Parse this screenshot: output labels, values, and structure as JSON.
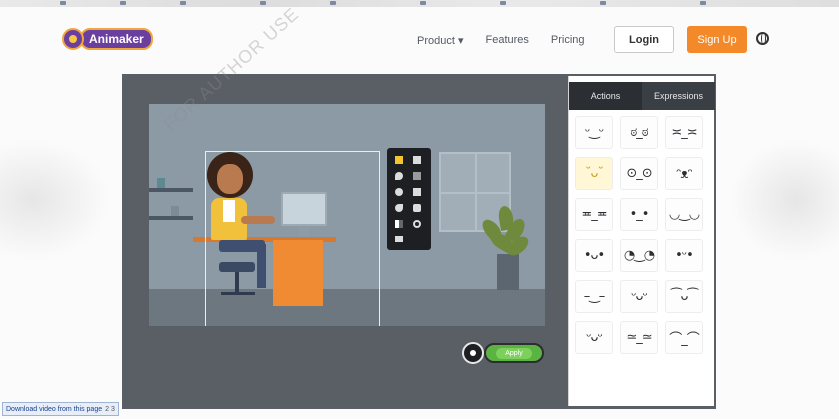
{
  "logo": {
    "text": "Animaker"
  },
  "nav": {
    "product": "Product ▾",
    "features": "Features",
    "pricing": "Pricing",
    "login": "Login",
    "signup": "Sign Up"
  },
  "watermark": "FOR AUTHOR USE",
  "editor": {
    "tabs": {
      "actions": "Actions",
      "expressions": "Expressions"
    },
    "active_tab": "Expressions",
    "apply_label": "Apply",
    "expressions": [
      "ᵕ‿ᵕ",
      "ಠ_ಠ",
      "≍_≍",
      "˘ᴗ˘",
      "⊙_⊙",
      "ᵔᴥᵔ",
      "≖_≖",
      "•_•",
      "◡‿◡",
      "•ᴗ•",
      "◔‿◔",
      "•ᵕ•",
      "–‿–",
      "ᵕᴗᵕ",
      "⁀ᴗ⁀",
      "ᵕᴗᵕ",
      "≃_≃",
      "⌒_⌒"
    ]
  },
  "download_bar": {
    "label": "Download video from this page",
    "pages": "2 3"
  },
  "colors": {
    "accent": "#f4892a",
    "brand": "#6b3fa0",
    "panel_dark": "#2b2e33",
    "apply_green": "#5bb342"
  }
}
